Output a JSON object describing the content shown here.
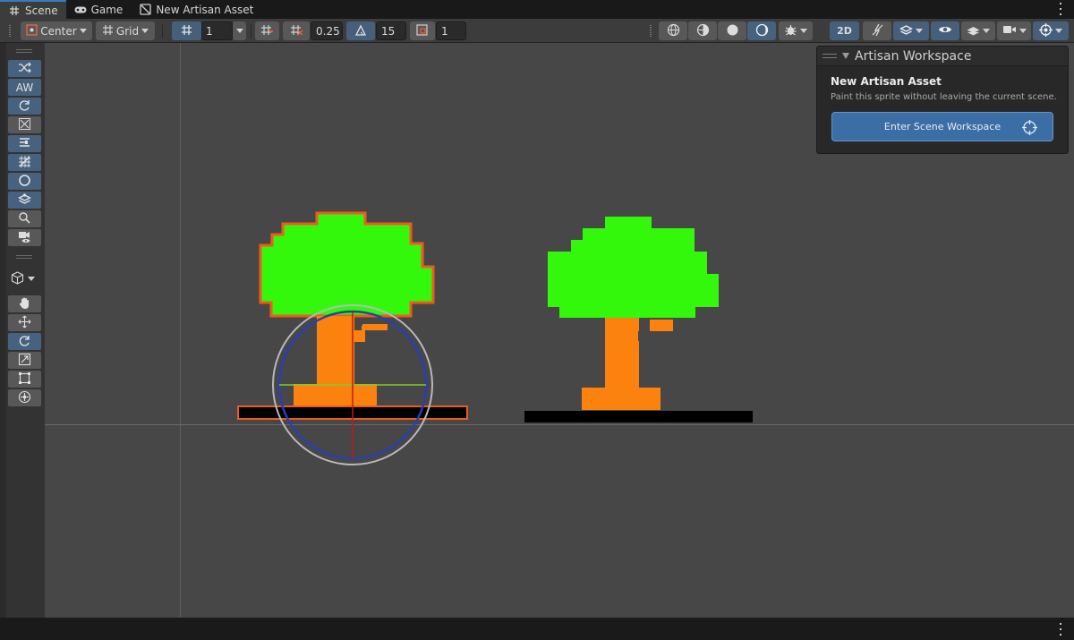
{
  "tabs": [
    {
      "label": "Scene",
      "icon": "grid-icon",
      "active": true
    },
    {
      "label": "Game",
      "icon": "gamepad-icon",
      "active": false
    },
    {
      "label": "New Artisan Asset",
      "icon": "artisan-asset-icon",
      "active": false
    }
  ],
  "toolbar": {
    "pivot_label": "Center",
    "handle_label": "Grid",
    "grid_size": "1",
    "snap_increment": "0.25",
    "rotation_snap": "15",
    "scale_snap": "1",
    "mode_2d_label": "2D"
  },
  "left_tools": {
    "artisan_label": "AW"
  },
  "overlay": {
    "title": "Artisan Workspace",
    "asset_name": "New Artisan Asset",
    "description": "Paint this sprite without leaving the current scene.",
    "button_label": "Enter Scene Workspace"
  },
  "colors": {
    "foliage": "#33f80c",
    "trunk": "#fb820f",
    "selection_outline": "#f05a1e",
    "accent_blue": "#3a6ea5",
    "scene_background": "#474747"
  }
}
